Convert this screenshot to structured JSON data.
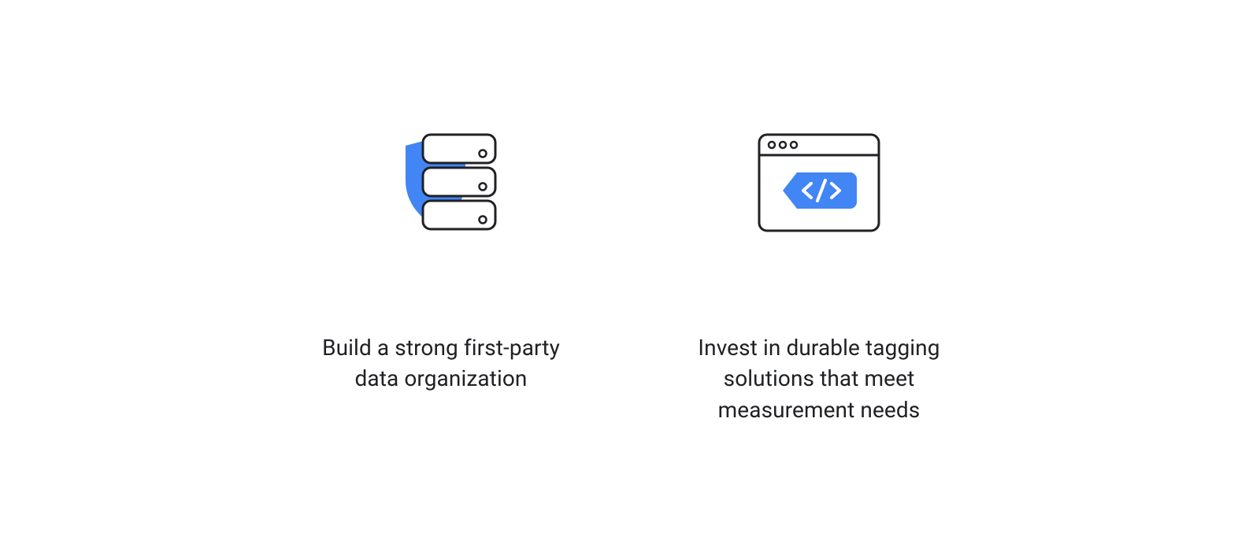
{
  "cards": [
    {
      "icon": "shield-servers-icon",
      "caption": "Build a strong first-party data organization"
    },
    {
      "icon": "browser-tag-icon",
      "caption": "Invest in durable tagging solutions that meet measurement needs"
    }
  ],
  "colors": {
    "accent": "#4285F4",
    "stroke": "#202124",
    "background": "#ffffff"
  }
}
